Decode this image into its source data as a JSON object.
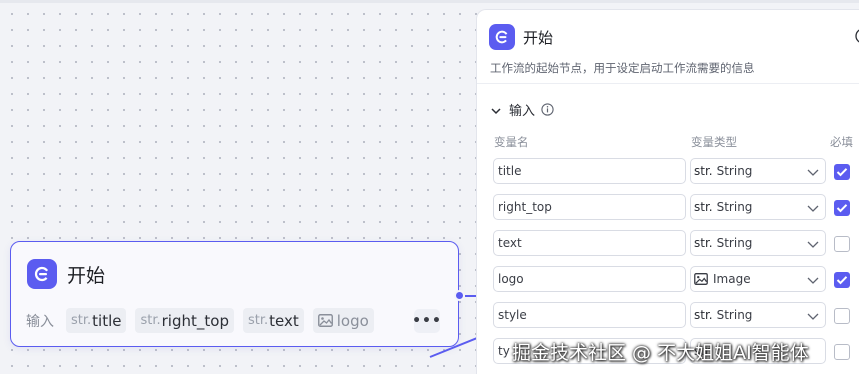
{
  "node": {
    "title": "开始",
    "io_label": "输入",
    "chips": [
      {
        "prefix": "str.",
        "name": "title"
      },
      {
        "prefix": "str.",
        "name": "right_top"
      },
      {
        "prefix": "str.",
        "name": "text"
      },
      {
        "prefix": "",
        "name": "logo"
      }
    ],
    "more": "•••"
  },
  "panel": {
    "title": "开始",
    "description": "工作流的起始节点，用于设定启动工作流需要的信息",
    "section_label": "输入",
    "columns": {
      "name": "变量名",
      "type": "变量类型",
      "required": "必填"
    },
    "rows": [
      {
        "name": "title",
        "type_prefix": "str.",
        "type": "String",
        "required": true
      },
      {
        "name": "right_top",
        "type_prefix": "str.",
        "type": "String",
        "required": true
      },
      {
        "name": "text",
        "type_prefix": "str.",
        "type": "String",
        "required": false
      },
      {
        "name": "logo",
        "type_prefix": "",
        "type": "Image",
        "required": true
      },
      {
        "name": "style",
        "type_prefix": "str.",
        "type": "String",
        "required": false
      },
      {
        "name": "ty",
        "type_prefix": "str.",
        "type": "",
        "required": false
      }
    ]
  },
  "watermark": "掘金技术社区 @ 不大姐姐AI智能体",
  "colors": {
    "accent": "#5b5cf0",
    "canvas": "#f2f3f7"
  }
}
